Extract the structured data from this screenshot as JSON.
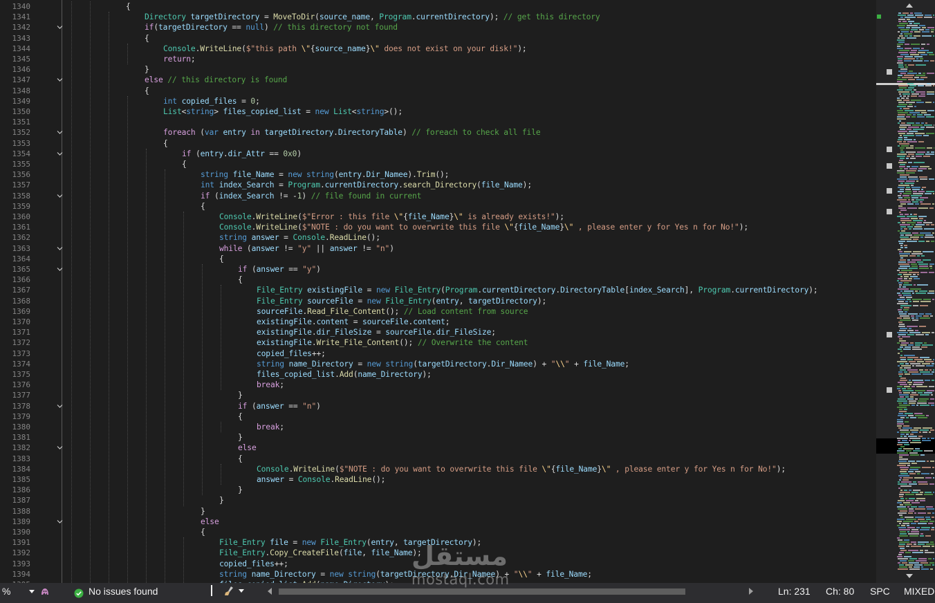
{
  "editor": {
    "first_line": 1340,
    "lines": [
      [
        [
          "p",
          "{"
        ]
      ],
      [
        [
          "t",
          "Directory"
        ],
        [
          "p",
          " "
        ],
        [
          "v",
          "targetDirectory"
        ],
        [
          "p",
          " = "
        ],
        [
          "m",
          "MoveToDir"
        ],
        [
          "p",
          "("
        ],
        [
          "v",
          "source_name"
        ],
        [
          "p",
          ", "
        ],
        [
          "t",
          "Program"
        ],
        [
          "p",
          "."
        ],
        [
          "v",
          "currentDirectory"
        ],
        [
          "p",
          "); "
        ],
        [
          "c",
          "// get this directory"
        ]
      ],
      [
        [
          "k",
          "if"
        ],
        [
          "p",
          "("
        ],
        [
          "v",
          "targetDirectory"
        ],
        [
          "p",
          " == "
        ],
        [
          "kb",
          "null"
        ],
        [
          "p",
          ") "
        ],
        [
          "c",
          "// this directory not found"
        ]
      ],
      [
        [
          "p",
          "{"
        ]
      ],
      [
        [
          "t",
          "Console"
        ],
        [
          "p",
          "."
        ],
        [
          "m",
          "WriteLine"
        ],
        [
          "p",
          "("
        ],
        [
          "s",
          "$\"this path "
        ],
        [
          "e",
          "\\\""
        ],
        [
          "p",
          "{"
        ],
        [
          "v",
          "source_name"
        ],
        [
          "p",
          "}"
        ],
        [
          "e",
          "\\\""
        ],
        [
          "s",
          " does not exist on your disk!\""
        ],
        [
          "p",
          ");"
        ]
      ],
      [
        [
          "k",
          "return"
        ],
        [
          "p",
          ";"
        ]
      ],
      [
        [
          "p",
          "}"
        ]
      ],
      [
        [
          "k",
          "else"
        ],
        [
          "p",
          " "
        ],
        [
          "c",
          "// this directory is found"
        ]
      ],
      [
        [
          "p",
          "{"
        ]
      ],
      [
        [
          "kb",
          "int"
        ],
        [
          "p",
          " "
        ],
        [
          "v",
          "copied_files"
        ],
        [
          "p",
          " = "
        ],
        [
          "n",
          "0"
        ],
        [
          "p",
          ";"
        ]
      ],
      [
        [
          "t",
          "List"
        ],
        [
          "p",
          "<"
        ],
        [
          "kb",
          "string"
        ],
        [
          "p",
          "> "
        ],
        [
          "v",
          "files_copied_list"
        ],
        [
          "p",
          " = "
        ],
        [
          "kb",
          "new"
        ],
        [
          "p",
          " "
        ],
        [
          "t",
          "List"
        ],
        [
          "p",
          "<"
        ],
        [
          "kb",
          "string"
        ],
        [
          "p",
          ">();"
        ]
      ],
      [
        [
          "p",
          ""
        ]
      ],
      [
        [
          "k",
          "foreach"
        ],
        [
          "p",
          " ("
        ],
        [
          "kb",
          "var"
        ],
        [
          "p",
          " "
        ],
        [
          "v",
          "entry"
        ],
        [
          "p",
          " "
        ],
        [
          "k",
          "in"
        ],
        [
          "p",
          " "
        ],
        [
          "v",
          "targetDirectory"
        ],
        [
          "p",
          "."
        ],
        [
          "v",
          "DirectoryTable"
        ],
        [
          "p",
          ") "
        ],
        [
          "c",
          "// foreach to check all file"
        ]
      ],
      [
        [
          "p",
          "{"
        ]
      ],
      [
        [
          "k",
          "if"
        ],
        [
          "p",
          " ("
        ],
        [
          "v",
          "entry"
        ],
        [
          "p",
          "."
        ],
        [
          "v",
          "dir_Attr"
        ],
        [
          "p",
          " == "
        ],
        [
          "n",
          "0x0"
        ],
        [
          "p",
          ")"
        ]
      ],
      [
        [
          "p",
          "{"
        ]
      ],
      [
        [
          "kb",
          "string"
        ],
        [
          "p",
          " "
        ],
        [
          "v",
          "file_Name"
        ],
        [
          "p",
          " = "
        ],
        [
          "kb",
          "new"
        ],
        [
          "p",
          " "
        ],
        [
          "kb",
          "string"
        ],
        [
          "p",
          "("
        ],
        [
          "v",
          "entry"
        ],
        [
          "p",
          "."
        ],
        [
          "v",
          "Dir_Namee"
        ],
        [
          "p",
          ")."
        ],
        [
          "m",
          "Trim"
        ],
        [
          "p",
          "();"
        ]
      ],
      [
        [
          "kb",
          "int"
        ],
        [
          "p",
          " "
        ],
        [
          "v",
          "index_Search"
        ],
        [
          "p",
          " = "
        ],
        [
          "t",
          "Program"
        ],
        [
          "p",
          "."
        ],
        [
          "v",
          "currentDirectory"
        ],
        [
          "p",
          "."
        ],
        [
          "m",
          "search_Directory"
        ],
        [
          "p",
          "("
        ],
        [
          "v",
          "file_Name"
        ],
        [
          "p",
          ");"
        ]
      ],
      [
        [
          "k",
          "if"
        ],
        [
          "p",
          " ("
        ],
        [
          "v",
          "index_Search"
        ],
        [
          "p",
          " != -"
        ],
        [
          "n",
          "1"
        ],
        [
          "p",
          ") "
        ],
        [
          "c",
          "// file found in current"
        ]
      ],
      [
        [
          "p",
          "{"
        ]
      ],
      [
        [
          "t",
          "Console"
        ],
        [
          "p",
          "."
        ],
        [
          "m",
          "WriteLine"
        ],
        [
          "p",
          "("
        ],
        [
          "s",
          "$\"Error : this file "
        ],
        [
          "e",
          "\\\""
        ],
        [
          "p",
          "{"
        ],
        [
          "v",
          "file_Name"
        ],
        [
          "p",
          "}"
        ],
        [
          "e",
          "\\\""
        ],
        [
          "s",
          " is already exists!\""
        ],
        [
          "p",
          ");"
        ]
      ],
      [
        [
          "t",
          "Console"
        ],
        [
          "p",
          "."
        ],
        [
          "m",
          "WriteLine"
        ],
        [
          "p",
          "("
        ],
        [
          "s",
          "$\"NOTE : do you want to overwrite this file "
        ],
        [
          "e",
          "\\\""
        ],
        [
          "p",
          "{"
        ],
        [
          "v",
          "file_Name"
        ],
        [
          "p",
          "}"
        ],
        [
          "e",
          "\\\""
        ],
        [
          "s",
          " , please enter y for Yes n for No!\""
        ],
        [
          "p",
          ");"
        ]
      ],
      [
        [
          "kb",
          "string"
        ],
        [
          "p",
          " "
        ],
        [
          "v",
          "answer"
        ],
        [
          "p",
          " = "
        ],
        [
          "t",
          "Console"
        ],
        [
          "p",
          "."
        ],
        [
          "m",
          "ReadLine"
        ],
        [
          "p",
          "();"
        ]
      ],
      [
        [
          "k",
          "while"
        ],
        [
          "p",
          " ("
        ],
        [
          "v",
          "answer"
        ],
        [
          "p",
          " != "
        ],
        [
          "s",
          "\"y\""
        ],
        [
          "p",
          " || "
        ],
        [
          "v",
          "answer"
        ],
        [
          "p",
          " != "
        ],
        [
          "s",
          "\"n\""
        ],
        [
          "p",
          ")"
        ]
      ],
      [
        [
          "p",
          "{"
        ]
      ],
      [
        [
          "k",
          "if"
        ],
        [
          "p",
          " ("
        ],
        [
          "v",
          "answer"
        ],
        [
          "p",
          " == "
        ],
        [
          "s",
          "\"y\""
        ],
        [
          "p",
          ")"
        ]
      ],
      [
        [
          "p",
          "{"
        ]
      ],
      [
        [
          "t",
          "File_Entry"
        ],
        [
          "p",
          " "
        ],
        [
          "v",
          "existingFile"
        ],
        [
          "p",
          " = "
        ],
        [
          "kb",
          "new"
        ],
        [
          "p",
          " "
        ],
        [
          "t",
          "File_Entry"
        ],
        [
          "p",
          "("
        ],
        [
          "t",
          "Program"
        ],
        [
          "p",
          "."
        ],
        [
          "v",
          "currentDirectory"
        ],
        [
          "p",
          "."
        ],
        [
          "v",
          "DirectoryTable"
        ],
        [
          "p",
          "["
        ],
        [
          "v",
          "index_Search"
        ],
        [
          "p",
          "], "
        ],
        [
          "t",
          "Program"
        ],
        [
          "p",
          "."
        ],
        [
          "v",
          "currentDirectory"
        ],
        [
          "p",
          ");"
        ]
      ],
      [
        [
          "t",
          "File_Entry"
        ],
        [
          "p",
          " "
        ],
        [
          "v",
          "sourceFile"
        ],
        [
          "p",
          " = "
        ],
        [
          "kb",
          "new"
        ],
        [
          "p",
          " "
        ],
        [
          "t",
          "File_Entry"
        ],
        [
          "p",
          "("
        ],
        [
          "v",
          "entry"
        ],
        [
          "p",
          ", "
        ],
        [
          "v",
          "targetDirectory"
        ],
        [
          "p",
          ");"
        ]
      ],
      [
        [
          "v",
          "sourceFile"
        ],
        [
          "p",
          "."
        ],
        [
          "m",
          "Read_File_Content"
        ],
        [
          "p",
          "(); "
        ],
        [
          "c",
          "// Load content from source"
        ]
      ],
      [
        [
          "v",
          "existingFile"
        ],
        [
          "p",
          "."
        ],
        [
          "v",
          "content"
        ],
        [
          "p",
          " = "
        ],
        [
          "v",
          "sourceFile"
        ],
        [
          "p",
          "."
        ],
        [
          "v",
          "content"
        ],
        [
          "p",
          ";"
        ]
      ],
      [
        [
          "v",
          "existingFile"
        ],
        [
          "p",
          "."
        ],
        [
          "v",
          "dir_FileSize"
        ],
        [
          "p",
          " = "
        ],
        [
          "v",
          "sourceFile"
        ],
        [
          "p",
          "."
        ],
        [
          "v",
          "dir_FileSize"
        ],
        [
          "p",
          ";"
        ]
      ],
      [
        [
          "v",
          "existingFile"
        ],
        [
          "p",
          "."
        ],
        [
          "m",
          "Write_File_Content"
        ],
        [
          "p",
          "(); "
        ],
        [
          "c",
          "// Overwrite the content"
        ]
      ],
      [
        [
          "v",
          "copied_files"
        ],
        [
          "p",
          "++;"
        ]
      ],
      [
        [
          "kb",
          "string"
        ],
        [
          "p",
          " "
        ],
        [
          "v",
          "name_Directory"
        ],
        [
          "p",
          " = "
        ],
        [
          "kb",
          "new"
        ],
        [
          "p",
          " "
        ],
        [
          "kb",
          "string"
        ],
        [
          "p",
          "("
        ],
        [
          "v",
          "targetDirectory"
        ],
        [
          "p",
          "."
        ],
        [
          "v",
          "Dir_Namee"
        ],
        [
          "p",
          ") + "
        ],
        [
          "s",
          "\""
        ],
        [
          "e",
          "\\\\"
        ],
        [
          "s",
          "\""
        ],
        [
          "p",
          " + "
        ],
        [
          "v",
          "file_Name"
        ],
        [
          "p",
          ";"
        ]
      ],
      [
        [
          "v",
          "files_copied_list"
        ],
        [
          "p",
          "."
        ],
        [
          "m",
          "Add"
        ],
        [
          "p",
          "("
        ],
        [
          "v",
          "name_Directory"
        ],
        [
          "p",
          ");"
        ]
      ],
      [
        [
          "k",
          "break"
        ],
        [
          "p",
          ";"
        ]
      ],
      [
        [
          "p",
          "}"
        ]
      ],
      [
        [
          "k",
          "if"
        ],
        [
          "p",
          " ("
        ],
        [
          "v",
          "answer"
        ],
        [
          "p",
          " == "
        ],
        [
          "s",
          "\"n\""
        ],
        [
          "p",
          ")"
        ]
      ],
      [
        [
          "p",
          "{"
        ]
      ],
      [
        [
          "k",
          "break"
        ],
        [
          "p",
          ";"
        ]
      ],
      [
        [
          "p",
          "}"
        ]
      ],
      [
        [
          "k",
          "else"
        ]
      ],
      [
        [
          "p",
          "{"
        ]
      ],
      [
        [
          "t",
          "Console"
        ],
        [
          "p",
          "."
        ],
        [
          "m",
          "WriteLine"
        ],
        [
          "p",
          "("
        ],
        [
          "s",
          "$\"NOTE : do you want to overwrite this file "
        ],
        [
          "e",
          "\\\""
        ],
        [
          "p",
          "{"
        ],
        [
          "v",
          "file_Name"
        ],
        [
          "p",
          "}"
        ],
        [
          "e",
          "\\\""
        ],
        [
          "s",
          " , please enter y for Yes n for No!\""
        ],
        [
          "p",
          ");"
        ]
      ],
      [
        [
          "v",
          "answer"
        ],
        [
          "p",
          " = "
        ],
        [
          "t",
          "Console"
        ],
        [
          "p",
          "."
        ],
        [
          "m",
          "ReadLine"
        ],
        [
          "p",
          "();"
        ]
      ],
      [
        [
          "p",
          "}"
        ]
      ],
      [
        [
          "p",
          "}"
        ]
      ],
      [
        [
          "p",
          "}"
        ]
      ],
      [
        [
          "k",
          "else"
        ]
      ],
      [
        [
          "p",
          "{"
        ]
      ],
      [
        [
          "t",
          "File_Entry"
        ],
        [
          "p",
          " "
        ],
        [
          "v",
          "file"
        ],
        [
          "p",
          " = "
        ],
        [
          "kb",
          "new"
        ],
        [
          "p",
          " "
        ],
        [
          "t",
          "File_Entry"
        ],
        [
          "p",
          "("
        ],
        [
          "v",
          "entry"
        ],
        [
          "p",
          ", "
        ],
        [
          "v",
          "targetDirectory"
        ],
        [
          "p",
          ");"
        ]
      ],
      [
        [
          "t",
          "File_Entry"
        ],
        [
          "p",
          "."
        ],
        [
          "m",
          "Copy_CreateFile"
        ],
        [
          "p",
          "("
        ],
        [
          "v",
          "file"
        ],
        [
          "p",
          ", "
        ],
        [
          "v",
          "file_Name"
        ],
        [
          "p",
          ");"
        ]
      ],
      [
        [
          "v",
          "copied_files"
        ],
        [
          "p",
          "++;"
        ]
      ],
      [
        [
          "kb",
          "string"
        ],
        [
          "p",
          " "
        ],
        [
          "v",
          "name_Directory"
        ],
        [
          "p",
          " = "
        ],
        [
          "kb",
          "new"
        ],
        [
          "p",
          " "
        ],
        [
          "kb",
          "string"
        ],
        [
          "p",
          "("
        ],
        [
          "v",
          "targetDirectory"
        ],
        [
          "p",
          "."
        ],
        [
          "v",
          "Dir_Namee"
        ],
        [
          "p",
          ") + "
        ],
        [
          "s",
          "\""
        ],
        [
          "e",
          "\\\\"
        ],
        [
          "s",
          "\""
        ],
        [
          "p",
          " + "
        ],
        [
          "v",
          "file_Name"
        ],
        [
          "p",
          ";"
        ]
      ],
      [
        [
          "v",
          "files_copied_list"
        ],
        [
          "p",
          "."
        ],
        [
          "m",
          "Add"
        ],
        [
          "p",
          "("
        ],
        [
          "v",
          "name_Directory"
        ],
        [
          "p",
          ");"
        ]
      ]
    ],
    "fold_icon": "chevron-down-icon",
    "colors": {
      "background": "#1e1e1e",
      "keyword": "#569cd6",
      "control": "#d8a0df",
      "type": "#4ec9b0",
      "method": "#dcdcaa",
      "variable": "#9cdcfe",
      "string": "#d69d85",
      "comment": "#57a64a",
      "number": "#b5cea8"
    }
  },
  "status_bar": {
    "zoom": "%",
    "issues_text": "No issues found",
    "issues_icon": "check-circle-icon",
    "ln": "Ln: 231",
    "ch": "Ch: 80",
    "spc": "SPC",
    "line_endings": "MIXED"
  },
  "watermark": {
    "arabic": "مستقل",
    "latin": "mostaql.com"
  }
}
